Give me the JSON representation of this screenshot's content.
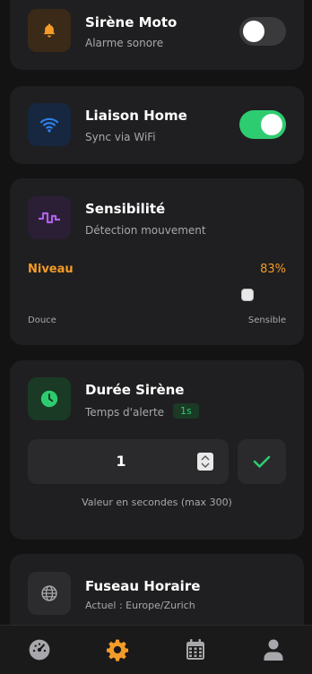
{
  "cards": {
    "siren": {
      "title": "Sirène Moto",
      "subtitle": "Alarme sonore",
      "toggle_on": false
    },
    "home": {
      "title": "Liaison Home",
      "subtitle": "Sync via WiFi",
      "toggle_on": true
    },
    "sensitivity": {
      "title": "Sensibilité",
      "subtitle": "Détection mouvement",
      "level_label": "Niveau",
      "level_value": "83%",
      "level_fraction": 0.83,
      "min_label": "Douce",
      "max_label": "Sensible"
    },
    "duration": {
      "title": "Durée Sirène",
      "subtitle": "Temps d'alerte",
      "badge": "1s",
      "input_value": "1",
      "hint": "Valeur en secondes (max 300)"
    },
    "timezone": {
      "title": "Fuseau Horaire",
      "subtitle": "Actuel : Europe/Zurich"
    }
  },
  "nav": {
    "items": [
      {
        "icon": "dashboard-icon",
        "active": false
      },
      {
        "icon": "gear-icon",
        "active": true
      },
      {
        "icon": "calendar-icon",
        "active": false
      },
      {
        "icon": "user-icon",
        "active": false
      }
    ]
  },
  "colors": {
    "accent_orange": "#f39c28",
    "accent_green": "#2ecc71",
    "accent_purple": "#b15fe6",
    "accent_blue": "#2f7fe6"
  }
}
